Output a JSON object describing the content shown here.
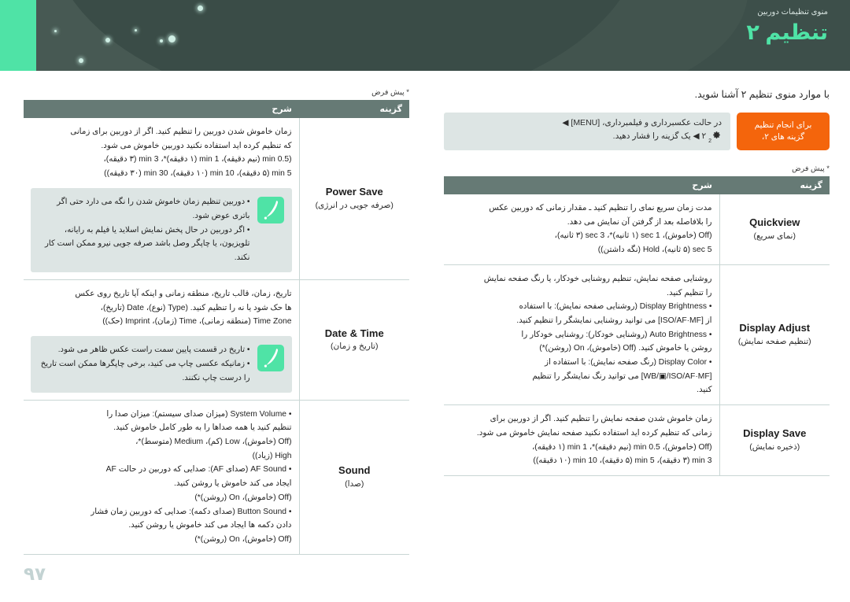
{
  "header": {
    "subtitle": "منوی تنظیمات دوربین",
    "title": "تنظیم ۲",
    "accent_color": "#4fe3a6",
    "banner_color": "#3d4f4a"
  },
  "right_column": {
    "intro": "با موارد منوی تنظیم ۲ آشنا شوید.",
    "howto": {
      "button_label": "برای انجام تنظیم گزینه های ۲،",
      "path_line1": "در حالت عکسبرداری و فیلمبرداری، [MENU] ◀",
      "path_line2": "۲ ◀ یک گزینه را فشار دهید."
    },
    "default_note": "* پیش فرض",
    "table": {
      "header_option": "گزینه",
      "header_description": "شرح",
      "rows": [
        {
          "option_en": "Quickview",
          "option_fa": "(نمای سریع)",
          "description": [
            "مدت زمان سریع نمای را تنظیم کنید ـ مقدار زمانی که دوربین عکس",
            "را بلافاصله بعد از گرفتن آن نمایش می دهد.",
            "(Off (خاموش)، 1 sec (۱ ثانیه)*، 3 sec (۳ ثانیه)،",
            "5 sec (۵ ثانیه)، Hold (نگه داشتن))"
          ]
        },
        {
          "option_en": "Display Adjust",
          "option_fa": "(تنظیم صفحه نمایش)",
          "description": [
            "روشنایی صفحه نمایش، تنظیم روشنایی خودکار، یا رنگ صفحه نمایش",
            "را تنظیم کنید.",
            "• Display Brightness (روشنایی صفحه نمایش): با استفاده",
            "از [ISO/AF·MF] می توانید روشنایی نمایشگر را تنظیم کنید.",
            "• Auto Brightness (روشنایی خودکار): روشنایی خودکار را",
            "روشن یا خاموش کنید. (Off (خاموش)، On (روشن)*)",
            "• Display Color (رنگ صفحه نمایش): با استفاده از",
            "[WB/▣/ISO/AF·MF] می توانید رنگ نمایشگر را تنظیم",
            "کنید."
          ]
        },
        {
          "option_en": "Display Save",
          "option_fa": "(ذخیره نمایش)",
          "description": [
            "زمان خاموش شدن صفحه نمایش را تنظیم کنید. اگر از دوربین برای",
            "زمانی که تنظیم کرده اید استفاده نکنید صفحه نمایش خاموش می شود.",
            "(Off (خاموش)، 0.5 min (نیم دقیقه)*، 1 min (۱ دقیقه)،",
            "3 min (۳ دقیقه)، 5 min (۵ دقیقه)، 10 min (۱۰ دقیقه))"
          ]
        }
      ]
    }
  },
  "left_column": {
    "default_note": "* پیش فرض",
    "table": {
      "header_option": "گزینه",
      "header_description": "شرح",
      "rows": [
        {
          "option_en": "Power Save",
          "option_fa": "(صرفه جویی در انرژی)",
          "description": [
            "زمان خاموش شدن دوربین را تنظیم کنید. اگر از دوربین برای زمانی",
            "که تنظیم کرده اید استفاده نکنید دوربین خاموش می شود.",
            "(0.5 min (نیم دقیقه)، 1 min (۱ دقیقه)*، 3 min (۳ دقیقه)،",
            "5 min (۵ دقیقه)، 10 min (۱۰ دقیقه)، 30 min (۳۰ دقیقه))"
          ],
          "tip": [
            "• دوربین تنظیم زمان خاموش شدن را نگه می دارد حتی اگر باتری عوض شود.",
            "• اگر دوربین در حال پخش نمایش اسلاید یا فیلم به رایانه، تلویزیون، یا چاپگر وصل باشد صرفه جویی نیرو ممکن است کار نکند."
          ]
        },
        {
          "option_en": "Date & Time",
          "option_fa": "(تاریخ و زمان)",
          "description": [
            "تاریخ، زمان، قالب تاریخ، منطقه زمانی و اینکه آیا تاریخ روی عکس",
            "ها حک شود یا نه را تنظیم کنید. (Type (نوع)، Date (تاریخ)،",
            "Time Zone (منطقه زمانی)، Time (زمان)، Imprint (حک))"
          ],
          "tip": [
            "• تاریخ در قسمت پایین سمت راست عکس ظاهر می شود.",
            "• زمانیکه عکسی چاپ می کنید، برخی چاپگرها ممکن است تاریخ را درست چاپ نکنند."
          ]
        },
        {
          "option_en": "Sound",
          "option_fa": "(صدا)",
          "description": [
            "• System Volume (میزان صدای سیستم): میزان صدا را",
            "تنظیم کنید یا همه صداها را به طور کامل خاموش کنید.",
            "(Off (خاموش)، Low (کم)، Medium (متوسط)*،",
            "High (زیاد))",
            "• AF Sound (صدای AF): صدایی که دوربین در حالت AF",
            "ایجاد می کند خاموش یا روشن کنید.",
            "(Off (خاموش)، On (روشن)*)",
            "• Button Sound (صدای دکمه): صدایی که دوربین زمان فشار",
            "دادن دکمه ها ایجاد می کند خاموش یا روشن کنید.",
            "(Off (خاموش)، On (روشن)*)"
          ]
        }
      ]
    }
  },
  "footer": {
    "page_number": "۹۷"
  }
}
